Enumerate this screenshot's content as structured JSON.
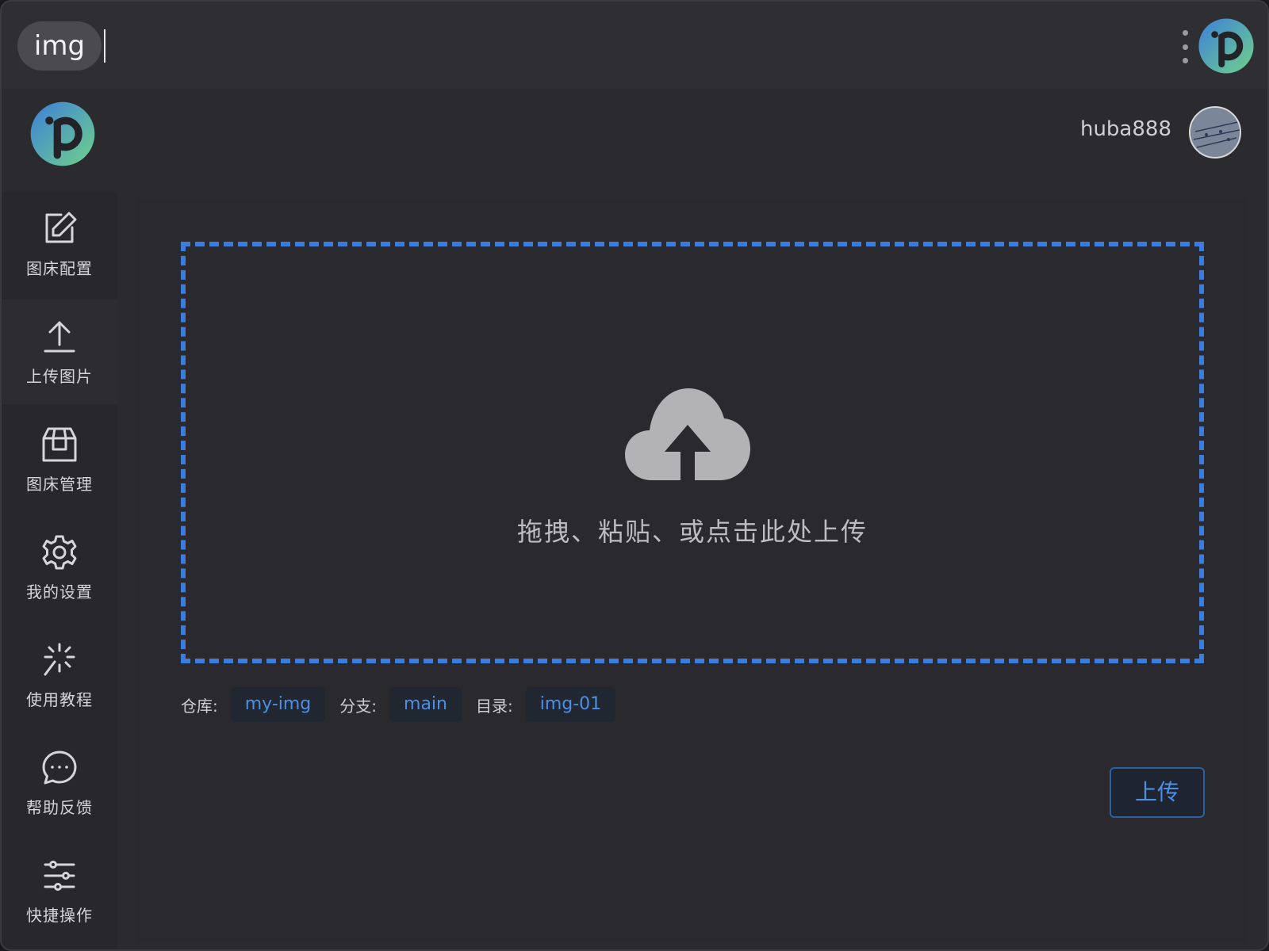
{
  "search": {
    "chip": "img",
    "value": ""
  },
  "header": {
    "username": "huba888"
  },
  "sidebar": {
    "items": [
      {
        "label": "图床配置",
        "icon": "edit-icon"
      },
      {
        "label": "上传图片",
        "icon": "upload-icon"
      },
      {
        "label": "图床管理",
        "icon": "box-icon"
      },
      {
        "label": "我的设置",
        "icon": "gear-icon"
      },
      {
        "label": "使用教程",
        "icon": "sparkle-icon"
      },
      {
        "label": "帮助反馈",
        "icon": "chat-icon"
      },
      {
        "label": "快捷操作",
        "icon": "sliders-icon"
      }
    ]
  },
  "main": {
    "dropzone_text": "拖拽、粘贴、或点击此处上传",
    "repo_label": "仓库:",
    "repo_value": "my-img",
    "branch_label": "分支:",
    "branch_value": "main",
    "dir_label": "目录:",
    "dir_value": "img-01",
    "upload_button": "上传"
  },
  "colors": {
    "accent": "#3b7ddd",
    "tag_text": "#4d8ee8",
    "background": "#2a2a2f"
  }
}
